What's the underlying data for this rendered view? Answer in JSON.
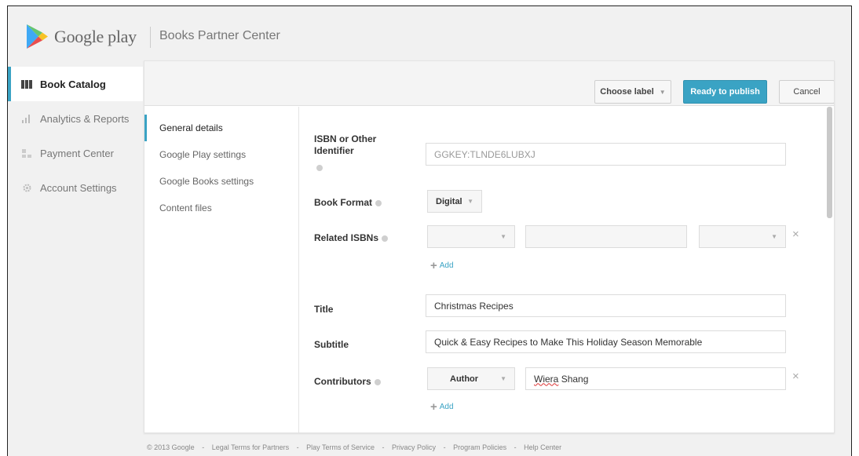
{
  "header": {
    "logo_text": "Google play",
    "product_name": "Books Partner Center"
  },
  "sidebar": {
    "items": [
      {
        "label": "Book Catalog",
        "icon": "book-catalog-icon",
        "active": true
      },
      {
        "label": "Analytics & Reports",
        "icon": "bar-chart-icon",
        "active": false
      },
      {
        "label": "Payment Center",
        "icon": "payment-icon",
        "active": false
      },
      {
        "label": "Account Settings",
        "icon": "gear-icon",
        "active": false
      }
    ]
  },
  "toolbar": {
    "choose_label": "Choose label",
    "publish_label": "Ready to publish",
    "cancel_label": "Cancel"
  },
  "subnav": {
    "items": [
      "General details",
      "Google Play settings",
      "Google Books settings",
      "Content files"
    ]
  },
  "form": {
    "isbn_label_line1": "ISBN or Other",
    "isbn_label_line2": "Identifier",
    "isbn_value": "GGKEY:TLNDE6LUBXJ",
    "format_label": "Book Format",
    "format_value": "Digital",
    "related_label": "Related ISBNs",
    "add_label": "Add",
    "title_label": "Title",
    "title_value": "Christmas Recipes",
    "subtitle_label": "Subtitle",
    "subtitle_value": "Quick & Easy Recipes to Make This Holiday Season Memorable",
    "contributors_label": "Contributors",
    "contributor_role": "Author",
    "contributor_first": "Wiera",
    "contributor_last": "Shang",
    "remove_symbol": "×"
  },
  "footer": {
    "links": [
      "© 2013 Google",
      "Legal Terms for Partners",
      "Play Terms of Service",
      "Privacy Policy",
      "Program Policies",
      "Help Center"
    ],
    "separator": "-"
  },
  "colors": {
    "accent": "#3aa3c4",
    "background": "#f1f1f1"
  }
}
